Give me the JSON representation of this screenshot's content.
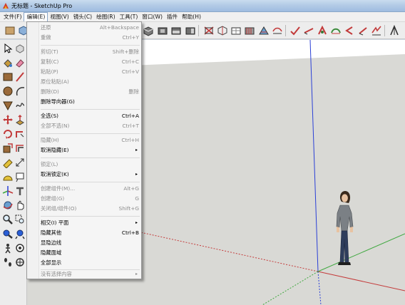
{
  "window": {
    "title": "无标题 - SketchUp Pro"
  },
  "menubar": {
    "items": [
      {
        "label": "文件(F)",
        "active": false
      },
      {
        "label": "编辑(E)",
        "active": true
      },
      {
        "label": "视图(V)",
        "active": false
      },
      {
        "label": "镜头(C)",
        "active": false
      },
      {
        "label": "绘图(R)",
        "active": false
      },
      {
        "label": "工具(T)",
        "active": false
      },
      {
        "label": "窗口(W)",
        "active": false
      },
      {
        "label": "插件",
        "active": false
      },
      {
        "label": "帮助(H)",
        "active": false
      }
    ]
  },
  "edit_menu": {
    "groups": [
      [
        {
          "label": "还原",
          "shortcut": "Alt+Backspace",
          "enabled": false
        },
        {
          "label": "重做",
          "shortcut": "Ctrl+Y",
          "enabled": false
        }
      ],
      [
        {
          "label": "剪切(T)",
          "shortcut": "Shift+删除",
          "enabled": false
        },
        {
          "label": "复制(C)",
          "shortcut": "Ctrl+C",
          "enabled": false
        },
        {
          "label": "粘贴(P)",
          "shortcut": "Ctrl+V",
          "enabled": false
        },
        {
          "label": "原位粘贴(A)",
          "shortcut": "",
          "enabled": false
        },
        {
          "label": "删除(D)",
          "shortcut": "删除",
          "enabled": false
        },
        {
          "label": "删除导向器(G)",
          "shortcut": "",
          "enabled": true
        }
      ],
      [
        {
          "label": "全选(S)",
          "shortcut": "Ctrl+A",
          "enabled": true
        },
        {
          "label": "全部不选(N)",
          "shortcut": "Ctrl+T",
          "enabled": false
        }
      ],
      [
        {
          "label": "隐藏(H)",
          "shortcut": "Ctrl+H",
          "enabled": false
        },
        {
          "label": "取消隐藏(E)",
          "shortcut": "",
          "enabled": true,
          "submenu": true
        }
      ],
      [
        {
          "label": "锁定(L)",
          "shortcut": "",
          "enabled": false
        },
        {
          "label": "取消锁定(K)",
          "shortcut": "",
          "enabled": true,
          "submenu": true
        }
      ],
      [
        {
          "label": "创建组件(M)...",
          "shortcut": "Alt+G",
          "enabled": false
        },
        {
          "label": "创建组(G)",
          "shortcut": "G",
          "enabled": false
        },
        {
          "label": "关闭组/组件(O)",
          "shortcut": "Shift+G",
          "enabled": false
        }
      ],
      [
        {
          "label": "相交(I) 平面",
          "shortcut": "",
          "enabled": true,
          "submenu": true
        },
        {
          "label": "隐藏其他",
          "shortcut": "Ctrl+B",
          "enabled": true
        },
        {
          "label": "显隐边线",
          "shortcut": "",
          "enabled": true
        },
        {
          "label": "隐藏面域",
          "shortcut": "",
          "enabled": true
        },
        {
          "label": "全部显示",
          "shortcut": "",
          "enabled": true
        }
      ],
      [
        {
          "label": "没有选择内容",
          "shortcut": "",
          "enabled": false,
          "submenu": true
        }
      ]
    ],
    "submenu_arrow": "▸"
  },
  "colors": {
    "axis_blue": "#2a3fd6",
    "axis_red": "#c43b3b",
    "axis_green": "#3fa83f",
    "sky": "#ffffff",
    "ground": "#d7d7d3"
  },
  "toolbar": {
    "icons": [
      "rectangle-icon",
      "components-icon",
      "paint-bucket-icon",
      "eraser-icon",
      "iso-view-icon",
      "top-view-icon",
      "front-view-icon",
      "right-view-icon",
      "back-view-icon",
      "left-view-icon",
      "xray-icon",
      "wireframe-icon",
      "hidden-line-icon",
      "shaded-icon",
      "textured-icon",
      "monochrome-icon",
      "orbit-icon",
      "pan-icon",
      "zoom-icon",
      "zoom-window-icon",
      "previous-view-icon",
      "next-view-icon",
      "zoom-extents-icon",
      "section-plane-icon",
      "walk-icon",
      "look-around-icon",
      "position-camera-icon"
    ]
  }
}
